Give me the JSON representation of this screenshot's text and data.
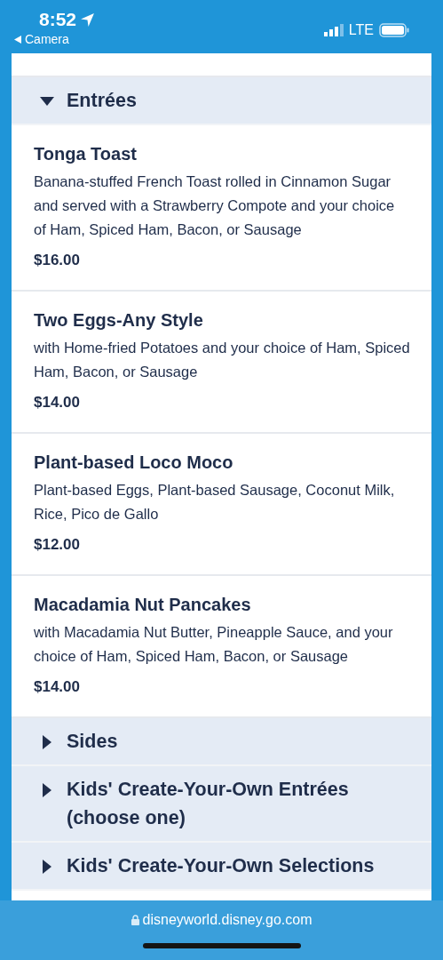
{
  "status_bar": {
    "time": "8:52",
    "back_label": "Camera",
    "network": "LTE"
  },
  "sections": [
    {
      "title": "Entrées",
      "expanded": true,
      "items": [
        {
          "name": "Tonga Toast",
          "description": "Banana-stuffed French Toast rolled in Cinnamon Sugar and served with a Strawberry Compote and your choice of Ham, Spiced Ham, Bacon, or Sausage",
          "price": "$16.00"
        },
        {
          "name": "Two Eggs-Any Style",
          "description": "with Home-fried Potatoes and your choice of Ham, Spiced Ham, Bacon, or Sausage",
          "price": "$14.00"
        },
        {
          "name": "Plant-based Loco Moco",
          "description": "Plant-based Eggs, Plant-based Sausage, Coconut Milk, Rice, Pico de Gallo",
          "price": "$12.00"
        },
        {
          "name": "Macadamia Nut Pancakes",
          "description": "with Macadamia Nut Butter, Pineapple Sauce, and your choice of Ham, Spiced Ham, Bacon, or Sausage",
          "price": "$14.00"
        }
      ]
    },
    {
      "title": "Sides",
      "expanded": false
    },
    {
      "title": "Kids' Create-Your-Own Entrées (choose one)",
      "expanded": false
    },
    {
      "title": "Kids' Create-Your-Own Selections",
      "expanded": false
    }
  ],
  "address_bar": {
    "url": "disneyworld.disney.go.com"
  }
}
